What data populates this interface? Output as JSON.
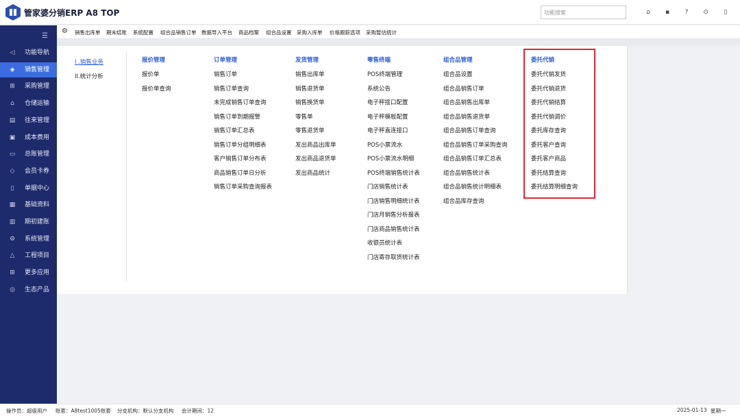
{
  "app": {
    "title": "管家婆分销ERP A8 TOP"
  },
  "search": {
    "placeholder": "功能搜索"
  },
  "top_icons": [
    "home-icon",
    "lock-icon",
    "help-icon",
    "user-icon",
    "trash-icon"
  ],
  "sidebar": {
    "items": [
      {
        "label": "功能导航",
        "icon": "send-icon",
        "glyph": "◁"
      },
      {
        "label": "销售管理",
        "icon": "tag-icon",
        "glyph": "◈",
        "active": true
      },
      {
        "label": "采购管理",
        "icon": "cart-icon",
        "glyph": "⊞"
      },
      {
        "label": "仓储运输",
        "icon": "warehouse-icon",
        "glyph": "⌂"
      },
      {
        "label": "往来管理",
        "icon": "ledger-icon",
        "glyph": "▤"
      },
      {
        "label": "成本费用",
        "icon": "cost-icon",
        "glyph": "▣"
      },
      {
        "label": "总账管理",
        "icon": "monitor-icon",
        "glyph": "▭"
      },
      {
        "label": "会员卡券",
        "icon": "diamond-icon",
        "glyph": "◇"
      },
      {
        "label": "单据中心",
        "icon": "document-icon",
        "glyph": "▯"
      },
      {
        "label": "基础资料",
        "icon": "database-icon",
        "glyph": "▦"
      },
      {
        "label": "期初建账",
        "icon": "book-icon",
        "glyph": "▥"
      },
      {
        "label": "系统管理",
        "icon": "settings-icon",
        "glyph": "⚙"
      },
      {
        "label": "工程项目",
        "icon": "warning-icon",
        "glyph": "△"
      },
      {
        "label": "更多应用",
        "icon": "apps-icon",
        "glyph": "⊞"
      },
      {
        "label": "生态产品",
        "icon": "ecosystem-icon",
        "glyph": "◎"
      }
    ]
  },
  "tabs": [
    "销售出库单",
    "期末结账",
    "系统配置",
    "组合品销售订单",
    "数据导入平台",
    "商品档案",
    "组合品设置",
    "采购入库单",
    "价格跟踪选项",
    "采购暂估统计"
  ],
  "menu": {
    "categories": [
      {
        "label": "I .销售业务",
        "active": true
      },
      {
        "label": "II.统计分析",
        "active": false
      }
    ],
    "columns": [
      {
        "heading": "报价管理",
        "items": [
          "报价单",
          "报价单查询"
        ]
      },
      {
        "heading": "订单管理",
        "items": [
          "销售订单",
          "销售订单查询",
          "未完成销售订单查询",
          "销售订单到期报警",
          "销售订单汇总表",
          "销售订单分组明细表",
          "客户销售订单分布表",
          "商品销售订单日分析",
          "销售订单采购查询报表"
        ]
      },
      {
        "heading": "发货管理",
        "items": [
          "销售出库单",
          "销售退货单",
          "销售换货单",
          "零售单",
          "零售退货单",
          "发出商品出库单",
          "发出商品退货单",
          "发出商品统计"
        ]
      },
      {
        "heading": "零售终端",
        "items": [
          "POS终端管理",
          "系统公告",
          "电子秤接口配置",
          "电子秤模板配置",
          "电子秤直连接口",
          "POS小票流水",
          "POS小票流水明细",
          "POS终端销售统计表",
          "门店销售统计表",
          "门店销售明细统计表",
          "门店月销售分析报表",
          "门店商品销售统计表",
          "收银员统计表",
          "门店寄存取货统计表"
        ]
      },
      {
        "heading": "组合品管理",
        "items": [
          "组合品设置",
          "组合品销售订单",
          "组合品销售出库单",
          "组合品销售退货单",
          "组合品销售订单查询",
          "组合品销售订单采购查询",
          "组合品销售订单汇总表",
          "组合品销售统计表",
          "组合品销售统计明细表",
          "组合品库存查询"
        ]
      },
      {
        "heading": "委托代销",
        "items": [
          "委托代销发货",
          "委托代销退货",
          "委托代销结算",
          "委托代销调价",
          "委托库存查询",
          "委托客户查询",
          "委托客户商品",
          "委托结算查询",
          "委托结算明细查询"
        ]
      }
    ]
  },
  "status": {
    "operator": "操作员：超级用户",
    "account": "账套：A8test1005账套",
    "branch": "分支机构：默认分支机构",
    "period": "会计期间：12",
    "date": "2025-01-13",
    "weekday": "星期一"
  },
  "colors": {
    "sidebar": "#1d2a6b",
    "accent": "#3b6de0",
    "link": "#2a5bd7",
    "highlight": "#e0262b"
  }
}
